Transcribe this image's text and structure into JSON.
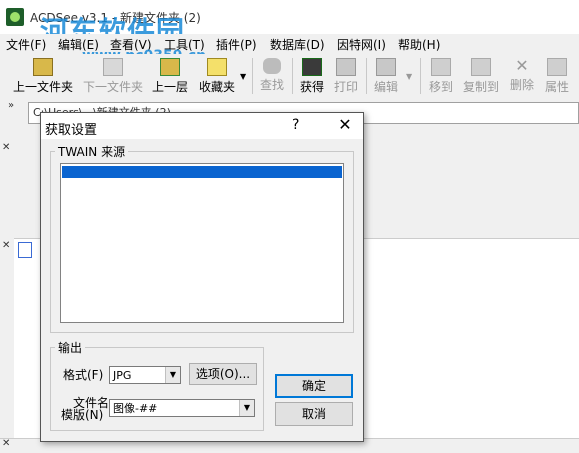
{
  "window": {
    "title": "ACDSee v3.1 - 新建文件夹 (2)",
    "watermark": "河东软件园",
    "watermark_url": "www.pc0359.cn"
  },
  "menu": [
    "文件(F)",
    "编辑(E)",
    "查看(V)",
    "工具(T)",
    "插件(P)",
    "数据库(D)",
    "因特网(I)",
    "帮助(H)"
  ],
  "toolbar": {
    "up_folder": "上一文件夹",
    "next_folder": "下一文件夹",
    "up_level": "上一层",
    "favorites": "收藏夹",
    "find": "查找",
    "acquire": "获得",
    "print": "打印",
    "edit": "编辑",
    "move": "移到",
    "copy": "复制到",
    "delete": "删除",
    "properties": "属性"
  },
  "address": {
    "value": "C:\\Users\\...\\新建文件夹 (2)"
  },
  "dialog": {
    "title": "获取设置",
    "help_glyph": "?",
    "close_glyph": "✕",
    "source_group": "TWAIN 来源",
    "output_group": "输出",
    "format_label": "格式(F)",
    "format_value": "JPG",
    "options_button": "选项(O)...",
    "filename_label_1": "文件名",
    "filename_label_2": "模版(N)",
    "filename_value": "图像-##",
    "ok_button": "确定",
    "cancel_button": "取消"
  },
  "colors": {
    "selection": "#0a64d0",
    "default_border": "#0078d7",
    "watermark": "#1a8ad8"
  }
}
